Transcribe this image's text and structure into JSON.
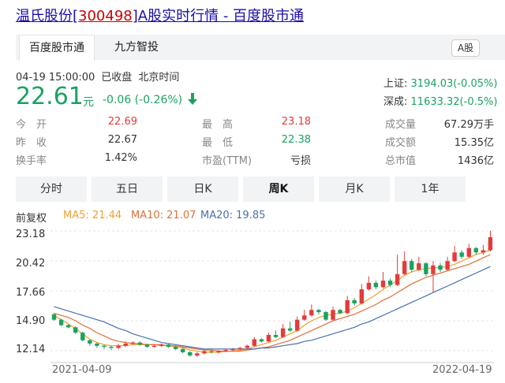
{
  "title": {
    "name": "温氏股份",
    "lbracket": "[",
    "code": "300498",
    "rbracket": "]",
    "suffix": "A股实时行情 - 百度股市通"
  },
  "tabs": [
    {
      "label": "百度股市通"
    },
    {
      "label": "九方智投"
    }
  ],
  "a_share_badge": "A股",
  "quote": {
    "datetime": "04-19 15:00:00",
    "status": "已收盘",
    "timezone": "北京时间",
    "price": "22.61",
    "unit": "元",
    "change": "-0.06 (-0.26%)"
  },
  "indices": [
    {
      "name": "上证:",
      "value": "3194.03(-0.05%)"
    },
    {
      "name": "深成:",
      "value": "11633.32(-0.5%)"
    }
  ],
  "stats": [
    {
      "label": "今　开",
      "value": "22.69",
      "color": "#e23b3b"
    },
    {
      "label": "最　高",
      "value": "23.18",
      "color": "#e23b3b"
    },
    {
      "label": "成交量",
      "value": "67.29万手",
      "color": "#333333"
    },
    {
      "label": "昨　收",
      "value": "22.67",
      "color": "#333333"
    },
    {
      "label": "最　低",
      "value": "22.38",
      "color": "#1aa260"
    },
    {
      "label": "成交额",
      "value": "15.35亿",
      "color": "#333333"
    },
    {
      "label": "换手率",
      "value": "1.42%",
      "color": "#333333"
    },
    {
      "label": "市盈(TTM)",
      "value": "亏损",
      "color": "#333333"
    },
    {
      "label": "总市值",
      "value": "1436亿",
      "color": "#333333"
    }
  ],
  "timeframes": [
    {
      "label": "分时"
    },
    {
      "label": "五日"
    },
    {
      "label": "日K"
    },
    {
      "label": "周K"
    },
    {
      "label": "月K"
    },
    {
      "label": "1年"
    }
  ],
  "active_timeframe": "周K",
  "adjust_label": "前复权",
  "ma_legend": [
    {
      "label": "MA5: 21.44",
      "color": "#f0a030"
    },
    {
      "label": "MA10: 21.07",
      "color": "#e0703a"
    },
    {
      "label": "MA20: 19.85",
      "color": "#4a6fb0"
    }
  ],
  "colors": {
    "up": "#e23b3b",
    "down": "#1aa260",
    "link": "#1a0dab"
  },
  "chart_data": {
    "type": "candlestick",
    "y_ticks": [
      "23.18",
      "20.42",
      "17.66",
      "14.90",
      "12.14"
    ],
    "ylim": [
      11.2,
      23.4
    ],
    "x_labels": [
      "2021-04-09",
      "2022-04-19"
    ],
    "candles": [
      [
        15.5,
        15.0,
        15.6,
        14.9
      ],
      [
        15.0,
        14.5,
        15.1,
        14.4
      ],
      [
        14.5,
        14.3,
        14.6,
        14.2
      ],
      [
        14.3,
        13.8,
        14.4,
        13.7
      ],
      [
        13.8,
        13.1,
        13.9,
        13.0
      ],
      [
        13.1,
        12.8,
        13.2,
        12.6
      ],
      [
        12.8,
        12.6,
        12.9,
        12.4
      ],
      [
        12.6,
        12.5,
        12.7,
        12.3
      ],
      [
        12.5,
        12.4,
        12.6,
        12.2
      ],
      [
        12.4,
        12.6,
        12.8,
        12.3
      ],
      [
        12.6,
        12.8,
        13.0,
        12.5
      ],
      [
        12.8,
        12.9,
        13.0,
        12.7
      ],
      [
        12.9,
        12.7,
        13.0,
        12.6
      ],
      [
        12.7,
        12.5,
        12.8,
        12.4
      ],
      [
        12.5,
        12.6,
        12.7,
        12.4
      ],
      [
        12.6,
        12.7,
        12.8,
        12.5
      ],
      [
        12.7,
        12.5,
        12.8,
        12.4
      ],
      [
        12.5,
        12.3,
        12.6,
        12.2
      ],
      [
        12.3,
        12.0,
        12.4,
        11.9
      ],
      [
        12.0,
        11.7,
        12.1,
        11.6
      ],
      [
        11.7,
        11.9,
        12.0,
        11.6
      ],
      [
        11.9,
        12.1,
        12.2,
        11.8
      ],
      [
        12.1,
        12.0,
        12.2,
        11.9
      ],
      [
        12.0,
        12.1,
        12.2,
        11.9
      ],
      [
        12.1,
        12.2,
        12.3,
        12.0
      ],
      [
        12.2,
        12.3,
        12.4,
        12.1
      ],
      [
        12.3,
        12.4,
        12.5,
        12.2
      ],
      [
        12.4,
        12.6,
        12.7,
        12.3
      ],
      [
        12.6,
        13.2,
        13.4,
        12.5
      ],
      [
        13.2,
        13.0,
        13.3,
        12.9
      ],
      [
        13.0,
        13.6,
        13.8,
        12.9
      ],
      [
        13.6,
        13.4,
        14.0,
        13.3
      ],
      [
        13.4,
        14.2,
        14.6,
        13.3
      ],
      [
        14.2,
        14.0,
        14.8,
        13.9
      ],
      [
        14.0,
        15.0,
        15.3,
        13.9
      ],
      [
        15.0,
        15.4,
        15.9,
        14.9
      ],
      [
        15.4,
        15.9,
        16.4,
        15.3
      ],
      [
        15.9,
        15.7,
        16.0,
        15.5
      ],
      [
        15.7,
        15.0,
        15.8,
        14.9
      ],
      [
        15.0,
        15.9,
        16.2,
        14.9
      ],
      [
        15.9,
        15.6,
        16.0,
        15.5
      ],
      [
        15.6,
        16.8,
        17.2,
        15.5
      ],
      [
        16.8,
        16.5,
        17.0,
        16.3
      ],
      [
        16.5,
        17.8,
        18.3,
        16.4
      ],
      [
        17.8,
        18.4,
        19.0,
        17.7
      ],
      [
        18.4,
        18.0,
        18.6,
        17.8
      ],
      [
        18.0,
        18.6,
        19.4,
        17.9
      ],
      [
        18.6,
        18.2,
        18.8,
        18.0
      ],
      [
        18.2,
        19.2,
        21.0,
        18.1
      ],
      [
        19.2,
        20.4,
        21.3,
        19.1
      ],
      [
        20.4,
        19.6,
        20.6,
        19.4
      ],
      [
        19.6,
        20.2,
        20.8,
        19.5
      ],
      [
        20.2,
        19.2,
        20.3,
        19.0
      ],
      [
        19.2,
        20.0,
        20.4,
        17.5
      ],
      [
        20.0,
        19.6,
        20.2,
        19.4
      ],
      [
        19.6,
        20.4,
        20.8,
        19.5
      ],
      [
        20.4,
        21.2,
        21.8,
        20.3
      ],
      [
        21.2,
        20.8,
        21.4,
        20.6
      ],
      [
        20.8,
        21.6,
        22.0,
        20.7
      ],
      [
        21.6,
        21.2,
        21.7,
        21.0
      ],
      [
        21.2,
        21.4,
        21.9,
        21.0
      ],
      [
        21.4,
        22.6,
        23.2,
        21.3
      ]
    ],
    "ma": [
      {
        "name": "MA5",
        "color": "#f0a030",
        "values": [
          15.4,
          15.0,
          14.6,
          14.2,
          13.7,
          13.2,
          12.9,
          12.7,
          12.6,
          12.6,
          12.6,
          12.7,
          12.7,
          12.7,
          12.7,
          12.6,
          12.6,
          12.5,
          12.4,
          12.2,
          12.1,
          12.0,
          12.0,
          12.0,
          12.1,
          12.1,
          12.2,
          12.3,
          12.5,
          12.7,
          12.9,
          13.1,
          13.4,
          13.7,
          14.0,
          14.5,
          14.9,
          15.2,
          15.4,
          15.5,
          15.6,
          15.8,
          16.1,
          16.5,
          16.9,
          17.3,
          17.8,
          18.2,
          18.6,
          19.1,
          19.4,
          19.6,
          19.7,
          19.8,
          19.8,
          19.9,
          20.1,
          20.4,
          20.7,
          21.0,
          21.2,
          21.4
        ]
      },
      {
        "name": "MA10",
        "color": "#e0703a",
        "values": [
          15.6,
          15.4,
          15.2,
          14.9,
          14.5,
          14.2,
          13.8,
          13.5,
          13.2,
          13.0,
          12.9,
          12.8,
          12.8,
          12.7,
          12.7,
          12.7,
          12.6,
          12.6,
          12.5,
          12.4,
          12.3,
          12.2,
          12.2,
          12.1,
          12.1,
          12.1,
          12.1,
          12.2,
          12.3,
          12.4,
          12.5,
          12.7,
          12.9,
          13.1,
          13.4,
          13.7,
          14.0,
          14.3,
          14.6,
          14.9,
          15.1,
          15.3,
          15.5,
          15.8,
          16.1,
          16.4,
          16.8,
          17.1,
          17.5,
          17.9,
          18.3,
          18.6,
          18.9,
          19.1,
          19.3,
          19.5,
          19.7,
          19.9,
          20.1,
          20.4,
          20.7,
          21.0
        ]
      },
      {
        "name": "MA20",
        "color": "#4a6fb0",
        "values": [
          16.2,
          16.0,
          15.8,
          15.6,
          15.4,
          15.2,
          15.0,
          14.8,
          14.5,
          14.2,
          14.0,
          13.7,
          13.5,
          13.3,
          13.1,
          12.9,
          12.8,
          12.7,
          12.6,
          12.5,
          12.4,
          12.3,
          12.3,
          12.3,
          12.3,
          12.3,
          12.3,
          12.3,
          12.3,
          12.4,
          12.4,
          12.5,
          12.6,
          12.7,
          12.8,
          13.0,
          13.1,
          13.3,
          13.5,
          13.7,
          13.9,
          14.1,
          14.3,
          14.6,
          14.8,
          15.1,
          15.4,
          15.7,
          16.0,
          16.3,
          16.6,
          16.9,
          17.2,
          17.5,
          17.8,
          18.1,
          18.4,
          18.7,
          19.0,
          19.3,
          19.6,
          19.9
        ]
      }
    ]
  }
}
